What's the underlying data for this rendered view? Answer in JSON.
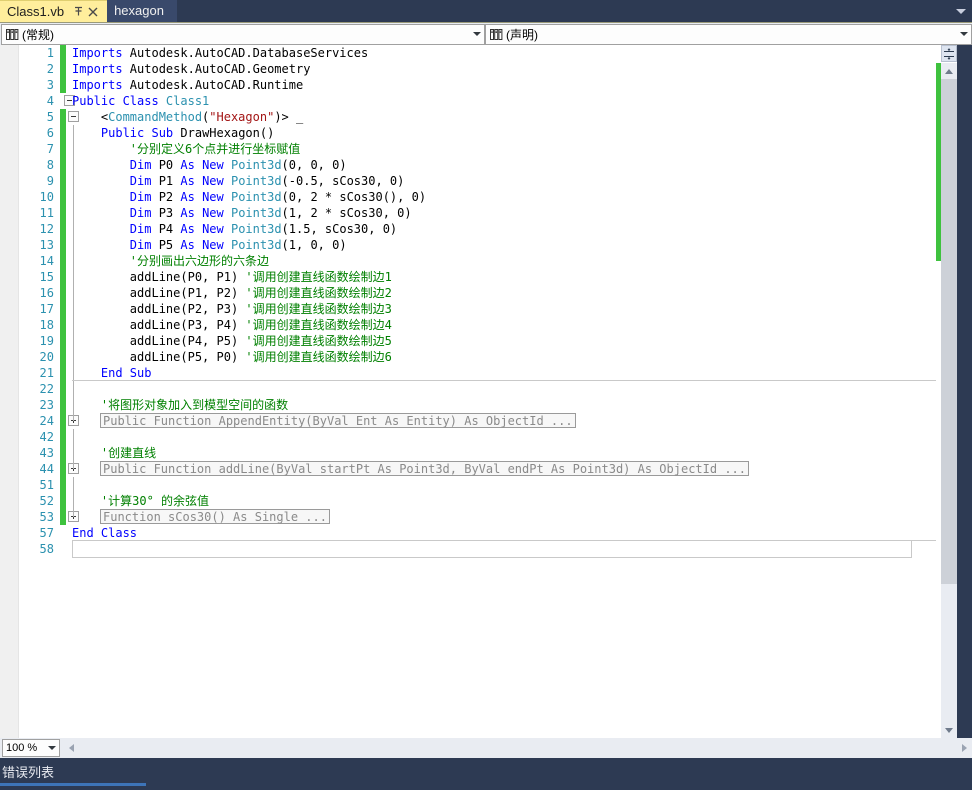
{
  "window": {
    "zoom_level": "100 %"
  },
  "tabs": {
    "active": {
      "label": "Class1.vb",
      "pin_icon": "pin-icon",
      "close_icon": "close-icon"
    },
    "inactive": {
      "label": "hexagon"
    },
    "dropdown_icon": "chevron-down-icon"
  },
  "navbar": {
    "scope": {
      "value": "(常规)",
      "icon": "class-members-icon"
    },
    "member": {
      "value": "(声明)",
      "icon": "class-members-icon"
    }
  },
  "editor": {
    "lines": [
      {
        "n": "1",
        "change": true,
        "fold": "none",
        "segs": [
          {
            "t": "Imports ",
            "c": "kw"
          },
          {
            "t": "Autodesk.AutoCAD.DatabaseServices",
            "c": "plain"
          }
        ]
      },
      {
        "n": "2",
        "change": true,
        "fold": "none",
        "segs": [
          {
            "t": "Imports ",
            "c": "kw"
          },
          {
            "t": "Autodesk.AutoCAD.Geometry",
            "c": "plain"
          }
        ]
      },
      {
        "n": "3",
        "change": true,
        "fold": "none",
        "segs": [
          {
            "t": "Imports ",
            "c": "kw"
          },
          {
            "t": "Autodesk.AutoCAD.Runtime",
            "c": "plain"
          }
        ]
      },
      {
        "n": "4",
        "change": false,
        "fold": "minus",
        "segs": [
          {
            "t": "Public Class ",
            "c": "kw"
          },
          {
            "t": "Class1",
            "c": "typ"
          }
        ]
      },
      {
        "n": "5",
        "change": true,
        "fold": "minus-indent",
        "segs": [
          {
            "t": "    <",
            "c": "plain"
          },
          {
            "t": "CommandMethod",
            "c": "typ"
          },
          {
            "t": "(",
            "c": "plain"
          },
          {
            "t": "\"Hexagon\"",
            "c": "str"
          },
          {
            "t": ")> _",
            "c": "plain"
          }
        ]
      },
      {
        "n": "6",
        "change": true,
        "fold": "line",
        "segs": [
          {
            "t": "    ",
            "c": "plain"
          },
          {
            "t": "Public Sub ",
            "c": "kw"
          },
          {
            "t": "DrawHexagon()",
            "c": "plain"
          }
        ]
      },
      {
        "n": "7",
        "change": true,
        "fold": "line",
        "segs": [
          {
            "t": "        ",
            "c": "plain"
          },
          {
            "t": "'分别定义6个点并进行坐标赋值",
            "c": "cmt"
          }
        ]
      },
      {
        "n": "8",
        "change": true,
        "fold": "line",
        "segs": [
          {
            "t": "        ",
            "c": "plain"
          },
          {
            "t": "Dim ",
            "c": "kw"
          },
          {
            "t": "P0 ",
            "c": "plain"
          },
          {
            "t": "As New ",
            "c": "kw"
          },
          {
            "t": "Point3d",
            "c": "typ"
          },
          {
            "t": "(0, 0, 0)",
            "c": "plain"
          }
        ]
      },
      {
        "n": "9",
        "change": true,
        "fold": "line",
        "segs": [
          {
            "t": "        ",
            "c": "plain"
          },
          {
            "t": "Dim ",
            "c": "kw"
          },
          {
            "t": "P1 ",
            "c": "plain"
          },
          {
            "t": "As New ",
            "c": "kw"
          },
          {
            "t": "Point3d",
            "c": "typ"
          },
          {
            "t": "(-0.5, sCos30, 0)",
            "c": "plain"
          }
        ]
      },
      {
        "n": "10",
        "change": true,
        "fold": "line",
        "segs": [
          {
            "t": "        ",
            "c": "plain"
          },
          {
            "t": "Dim ",
            "c": "kw"
          },
          {
            "t": "P2 ",
            "c": "plain"
          },
          {
            "t": "As New ",
            "c": "kw"
          },
          {
            "t": "Point3d",
            "c": "typ"
          },
          {
            "t": "(0, 2 * sCos30(), 0)",
            "c": "plain"
          }
        ]
      },
      {
        "n": "11",
        "change": true,
        "fold": "line",
        "segs": [
          {
            "t": "        ",
            "c": "plain"
          },
          {
            "t": "Dim ",
            "c": "kw"
          },
          {
            "t": "P3 ",
            "c": "plain"
          },
          {
            "t": "As New ",
            "c": "kw"
          },
          {
            "t": "Point3d",
            "c": "typ"
          },
          {
            "t": "(1, 2 * sCos30, 0)",
            "c": "plain"
          }
        ]
      },
      {
        "n": "12",
        "change": true,
        "fold": "line",
        "segs": [
          {
            "t": "        ",
            "c": "plain"
          },
          {
            "t": "Dim ",
            "c": "kw"
          },
          {
            "t": "P4 ",
            "c": "plain"
          },
          {
            "t": "As New ",
            "c": "kw"
          },
          {
            "t": "Point3d",
            "c": "typ"
          },
          {
            "t": "(1.5, sCos30, 0)",
            "c": "plain"
          }
        ]
      },
      {
        "n": "13",
        "change": true,
        "fold": "line",
        "segs": [
          {
            "t": "        ",
            "c": "plain"
          },
          {
            "t": "Dim ",
            "c": "kw"
          },
          {
            "t": "P5 ",
            "c": "plain"
          },
          {
            "t": "As New ",
            "c": "kw"
          },
          {
            "t": "Point3d",
            "c": "typ"
          },
          {
            "t": "(1, 0, 0)",
            "c": "plain"
          }
        ]
      },
      {
        "n": "14",
        "change": true,
        "fold": "line",
        "segs": [
          {
            "t": "        ",
            "c": "plain"
          },
          {
            "t": "'分别画出六边形的六条边",
            "c": "cmt"
          }
        ]
      },
      {
        "n": "15",
        "change": true,
        "fold": "line",
        "segs": [
          {
            "t": "        addLine(P0, P1) ",
            "c": "plain"
          },
          {
            "t": "'调用创建直线函数绘制边1",
            "c": "cmt"
          }
        ]
      },
      {
        "n": "16",
        "change": true,
        "fold": "line",
        "segs": [
          {
            "t": "        addLine(P1, P2) ",
            "c": "plain"
          },
          {
            "t": "'调用创建直线函数绘制边2",
            "c": "cmt"
          }
        ]
      },
      {
        "n": "17",
        "change": true,
        "fold": "line",
        "segs": [
          {
            "t": "        addLine(P2, P3) ",
            "c": "plain"
          },
          {
            "t": "'调用创建直线函数绘制边3",
            "c": "cmt"
          }
        ]
      },
      {
        "n": "18",
        "change": true,
        "fold": "line",
        "segs": [
          {
            "t": "        addLine(P3, P4) ",
            "c": "plain"
          },
          {
            "t": "'调用创建直线函数绘制边4",
            "c": "cmt"
          }
        ]
      },
      {
        "n": "19",
        "change": true,
        "fold": "line",
        "segs": [
          {
            "t": "        addLine(P4, P5) ",
            "c": "plain"
          },
          {
            "t": "'调用创建直线函数绘制边5",
            "c": "cmt"
          }
        ]
      },
      {
        "n": "20",
        "change": true,
        "fold": "line",
        "segs": [
          {
            "t": "        addLine(P5, P0) ",
            "c": "plain"
          },
          {
            "t": "'调用创建直线函数绘制边6",
            "c": "cmt"
          }
        ]
      },
      {
        "n": "21",
        "change": true,
        "fold": "line",
        "rule": true,
        "segs": [
          {
            "t": "    ",
            "c": "plain"
          },
          {
            "t": "End Sub",
            "c": "kw"
          }
        ]
      },
      {
        "n": "22",
        "change": true,
        "fold": "line",
        "segs": []
      },
      {
        "n": "23",
        "change": true,
        "fold": "line",
        "segs": [
          {
            "t": "    ",
            "c": "plain"
          },
          {
            "t": "'将图形对象加入到模型空间的函数",
            "c": "cmt"
          }
        ]
      },
      {
        "n": "24",
        "change": true,
        "fold": "plus",
        "collapsed": "Public Function AppendEntity(ByVal Ent As Entity) As ObjectId ..."
      },
      {
        "n": "42",
        "change": true,
        "fold": "line",
        "segs": []
      },
      {
        "n": "43",
        "change": true,
        "fold": "line",
        "segs": [
          {
            "t": "    ",
            "c": "plain"
          },
          {
            "t": "'创建直线",
            "c": "cmt"
          }
        ]
      },
      {
        "n": "44",
        "change": true,
        "fold": "plus",
        "collapsed": "Public Function addLine(ByVal startPt As Point3d, ByVal endPt As Point3d) As ObjectId ..."
      },
      {
        "n": "51",
        "change": true,
        "fold": "line",
        "segs": []
      },
      {
        "n": "52",
        "change": true,
        "fold": "line",
        "segs": [
          {
            "t": "    ",
            "c": "plain"
          },
          {
            "t": "'计算30° 的余弦值",
            "c": "cmt"
          }
        ]
      },
      {
        "n": "53",
        "change": true,
        "fold": "plus",
        "collapsed": "Function sCos30() As Single ..."
      },
      {
        "n": "57",
        "change": false,
        "fold": "none",
        "rule": true,
        "segs": [
          {
            "t": "End Class",
            "c": "kw"
          }
        ]
      },
      {
        "n": "58",
        "change": false,
        "fold": "none",
        "emptybox": true,
        "segs": []
      }
    ]
  },
  "scrollbars": {
    "split_icon": "split-view-icon",
    "up_icon": "triangle-up-icon",
    "down_icon": "triangle-down-icon",
    "left_icon": "triangle-left-icon",
    "right_icon": "triangle-right-icon"
  },
  "dock": {
    "error_list_label": "错误列表"
  },
  "colors": {
    "chrome": "#2d3a53",
    "active_tab": "#ffee9c",
    "inactive_tab": "#39496b",
    "keyword": "#0000ff",
    "type": "#2b91af",
    "string": "#a31515",
    "comment": "#008000",
    "line_number": "#2b91af",
    "change_bar": "#3ec23e",
    "accent_underline": "#3d74b8"
  }
}
